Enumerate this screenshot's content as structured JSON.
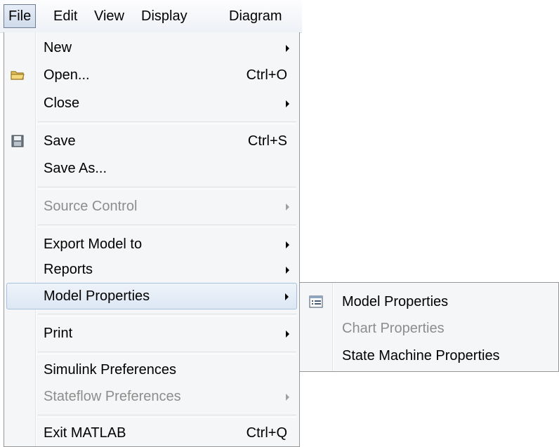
{
  "menubar": {
    "items": [
      {
        "label": "File",
        "active": true
      },
      {
        "label": "Edit"
      },
      {
        "label": "View"
      },
      {
        "label": "Display"
      },
      {
        "label": "Diagram"
      }
    ]
  },
  "file_menu": {
    "items": [
      {
        "label": "New",
        "submenu": true
      },
      {
        "label": "Open...",
        "accelerator": "Ctrl+O",
        "icon": "folder-icon"
      },
      {
        "label": "Close",
        "submenu": true
      },
      {
        "label": "Save",
        "accelerator": "Ctrl+S",
        "icon": "floppy-disk-icon"
      },
      {
        "label": "Save As..."
      },
      {
        "label": "Source Control",
        "submenu": true,
        "disabled": true
      },
      {
        "label": "Export Model to",
        "submenu": true
      },
      {
        "label": "Reports",
        "submenu": true
      },
      {
        "label": "Model Properties",
        "submenu": true,
        "highlighted": true
      },
      {
        "label": "Print",
        "submenu": true
      },
      {
        "label": "Simulink Preferences"
      },
      {
        "label": "Stateflow Preferences",
        "submenu": true,
        "disabled": true
      },
      {
        "label": "Exit MATLAB",
        "accelerator": "Ctrl+Q"
      }
    ]
  },
  "model_properties_submenu": {
    "items": [
      {
        "label": "Model Properties",
        "icon": "properties-list-icon"
      },
      {
        "label": "Chart Properties",
        "disabled": true
      },
      {
        "label": "State Machine Properties"
      }
    ]
  },
  "colors": {
    "menu_background": "#f5f6f7",
    "highlight": "#dce7f4",
    "disabled_text": "#8d8d8d"
  }
}
